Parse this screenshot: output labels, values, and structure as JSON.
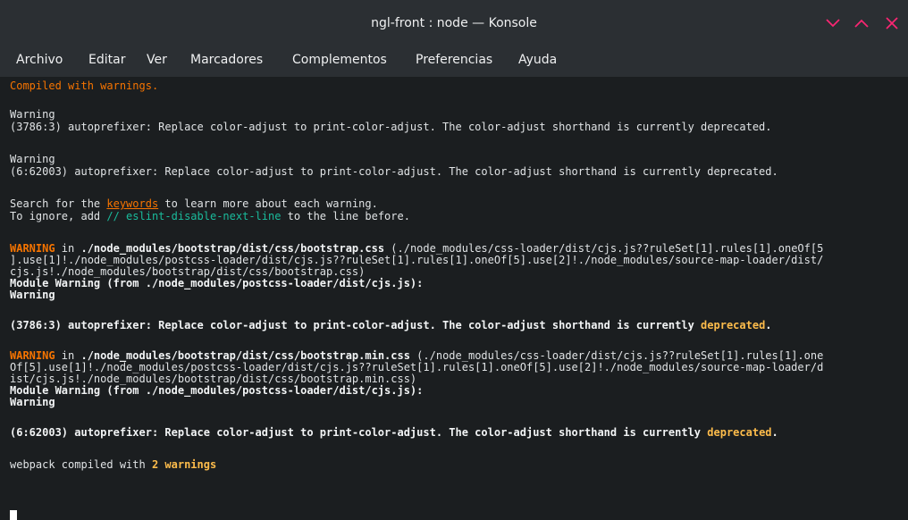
{
  "window": {
    "title": "ngl-front : node — Konsole",
    "controls": {
      "minimize_icon": "chevron-down-icon",
      "maximize_icon": "chevron-up-icon",
      "close_icon": "close-icon",
      "accent_color": "#f92672"
    }
  },
  "menubar": {
    "items": [
      "Archivo",
      "Editar",
      "Ver",
      "Marcadores",
      "Complementos",
      "Preferencias",
      "Ayuda"
    ]
  },
  "terminal": {
    "colors": {
      "background": "#1b1e20",
      "text": "#e0e3e5",
      "warning": "#f67400",
      "comment": "#1abc9c",
      "highlight": "#fdbc4b"
    },
    "compiled_warnings": "Compiled with warnings.",
    "w1_header": "Warning",
    "w1_text": "(3786:3) autoprefixer: Replace color-adjust to print-color-adjust. The color-adjust shorthand is currently deprecated.",
    "w2_header": "Warning",
    "w2_text": "(6:62003) autoprefixer: Replace color-adjust to print-color-adjust. The color-adjust shorthand is currently deprecated.",
    "search_pre": "Search for the ",
    "search_link": "keywords",
    "search_post": " to learn more about each warning.",
    "ignore_pre": "To ignore, add ",
    "ignore_comment": "// eslint-disable-next-line",
    "ignore_post": " to the line before.",
    "b1_label": "WARNING",
    "b1_in": " in ",
    "b1_file": "./node_modules/bootstrap/dist/css/bootstrap.css",
    "b1_path1": " (./node_modules/css-loader/dist/cjs.js??ruleSet[1].rules[1].oneOf[5",
    "b1_path2": "].use[1]!./node_modules/postcss-loader/dist/cjs.js??ruleSet[1].rules[1].oneOf[5].use[2]!./node_modules/source-map-loader/dist/",
    "b1_path3": "cjs.js!./node_modules/bootstrap/dist/css/bootstrap.css)",
    "b1_module": "Module Warning (from ./node_modules/postcss-loader/dist/cjs.js):",
    "b1_warning": "Warning",
    "b1_msg": "(3786:3) autoprefixer: Replace color-adjust to print-color-adjust. The color-adjust shorthand is currently ",
    "b1_deprecated": "deprecated",
    "b1_end": ".",
    "b2_label": "WARNING",
    "b2_in": " in ",
    "b2_file": "./node_modules/bootstrap/dist/css/bootstrap.min.css",
    "b2_path1": " (./node_modules/css-loader/dist/cjs.js??ruleSet[1].rules[1].one",
    "b2_path2": "Of[5].use[1]!./node_modules/postcss-loader/dist/cjs.js??ruleSet[1].rules[1].oneOf[5].use[2]!./node_modules/source-map-loader/d",
    "b2_path3": "ist/cjs.js!./node_modules/bootstrap/dist/css/bootstrap.min.css)",
    "b2_module": "Module Warning (from ./node_modules/postcss-loader/dist/cjs.js):",
    "b2_warning": "Warning",
    "b2_msg": "(6:62003) autoprefixer: Replace color-adjust to print-color-adjust. The color-adjust shorthand is currently ",
    "b2_deprecated": "deprecated",
    "b2_end": ".",
    "final_pre": "webpack compiled with ",
    "final_count": "2 warnings"
  }
}
